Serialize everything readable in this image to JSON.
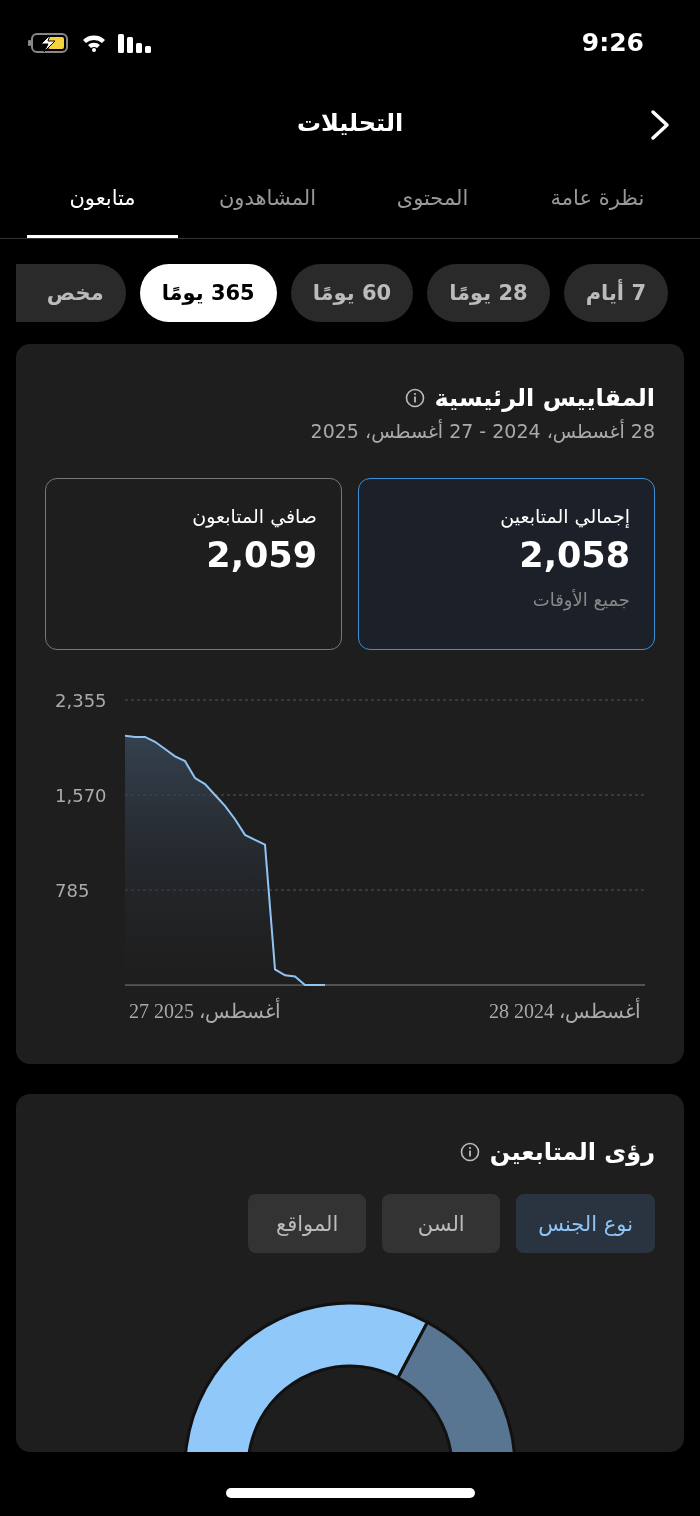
{
  "status_bar": {
    "time": "9:26"
  },
  "header": {
    "title": "التحليلات"
  },
  "tabs": [
    {
      "label": "نظرة عامة",
      "selected": false
    },
    {
      "label": "المحتوى",
      "selected": false
    },
    {
      "label": "المشاهدون",
      "selected": false
    },
    {
      "label": "متابعون",
      "selected": true
    }
  ],
  "ranges": [
    {
      "label": "7 أيام",
      "selected": false
    },
    {
      "label": "28 يومًا",
      "selected": false
    },
    {
      "label": "60 يومًا",
      "selected": false
    },
    {
      "label": "365 يومًا",
      "selected": true
    },
    {
      "label": "مخص",
      "selected": false
    }
  ],
  "key_metrics": {
    "title": "المقاييس الرئيسية",
    "date_range": "28 أغسطس، 2024 - 27 أغسطس، 2025",
    "metrics": [
      {
        "label": "إجمالي المتابعين",
        "value": "2,058",
        "note": "جميع الأوقات",
        "selected": true
      },
      {
        "label": "صافي المتابعون",
        "value": "2,059",
        "selected": false
      }
    ],
    "chart_data": {
      "type": "area",
      "categories": [
        null,
        null,
        null,
        null,
        null,
        null,
        null,
        null,
        "أغسطس، 2025 27",
        null,
        null,
        null,
        null,
        null,
        null,
        null,
        null,
        null,
        null,
        null,
        null,
        null,
        null,
        null,
        null,
        null,
        null,
        null,
        null,
        null,
        null,
        null,
        null,
        null,
        null,
        null,
        null,
        null,
        null,
        null,
        null,
        null,
        null,
        null,
        "أغسطس، 2024 28",
        null,
        null,
        null,
        null,
        null,
        null,
        null,
        null
      ],
      "values": [
        2060,
        2050,
        2050,
        2010,
        1950,
        1890,
        1850,
        1710,
        1660,
        1570,
        1480,
        1370,
        1240,
        1200,
        1160,
        130,
        80,
        70,
        0,
        0,
        0,
        null,
        null,
        null,
        null,
        null,
        null,
        null,
        null,
        null,
        null,
        null,
        null,
        null,
        null,
        null,
        null,
        null,
        null,
        null,
        null,
        null,
        null,
        null,
        null,
        null,
        null,
        null,
        null,
        null,
        null,
        null,
        null
      ],
      "ylim": [
        0,
        2355
      ],
      "yticks": [
        {
          "value": 785,
          "label": "785"
        },
        {
          "value": 1570,
          "label": "1,570"
        },
        {
          "value": 2355,
          "label": "2,355"
        }
      ]
    }
  },
  "follower_insights": {
    "title": "رؤى المتابعين",
    "tabs": [
      {
        "label": "نوع الجنس",
        "selected": true
      },
      {
        "label": "السن",
        "selected": false
      },
      {
        "label": "المواقع",
        "selected": false
      }
    ]
  }
}
